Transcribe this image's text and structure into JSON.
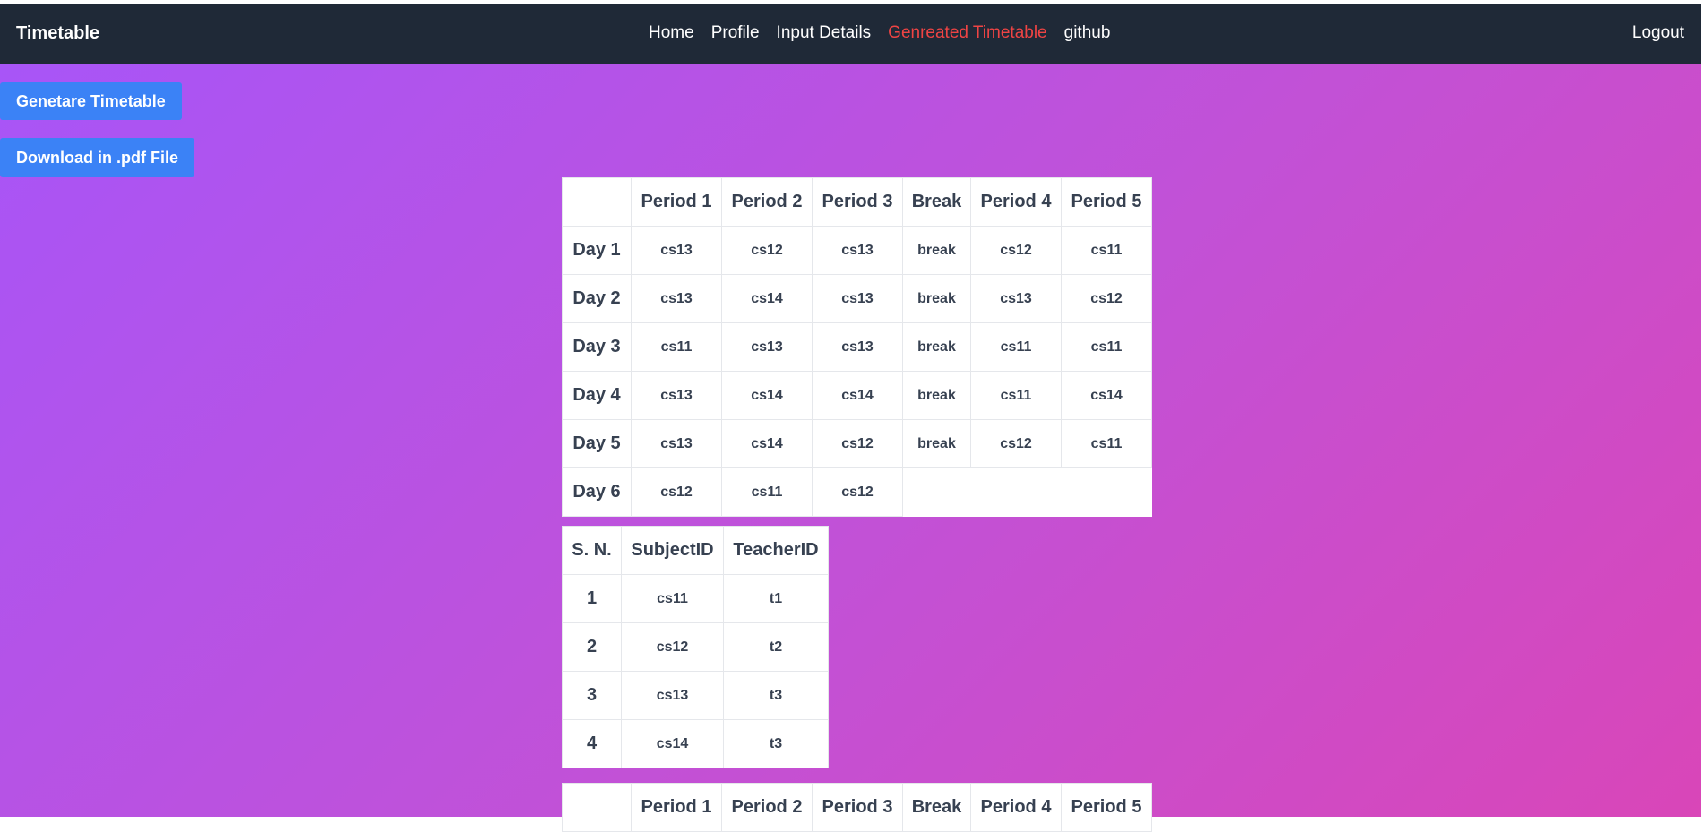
{
  "nav": {
    "brand": "Timetable",
    "links": [
      "Home",
      "Profile",
      "Input Details",
      "Genreated Timetable",
      "github"
    ],
    "logout": "Logout"
  },
  "actions": {
    "generate": "Genetare Timetable",
    "download": "Download in .pdf File"
  },
  "timetable": {
    "headers": [
      "",
      "Period 1",
      "Period 2",
      "Period 3",
      "Break",
      "Period 4",
      "Period 5"
    ],
    "rows": [
      [
        "Day 1",
        "cs13",
        "cs12",
        "cs13",
        "break",
        "cs12",
        "cs11"
      ],
      [
        "Day 2",
        "cs13",
        "cs14",
        "cs13",
        "break",
        "cs13",
        "cs12"
      ],
      [
        "Day 3",
        "cs11",
        "cs13",
        "cs13",
        "break",
        "cs11",
        "cs11"
      ],
      [
        "Day 4",
        "cs13",
        "cs14",
        "cs14",
        "break",
        "cs11",
        "cs14"
      ],
      [
        "Day 5",
        "cs13",
        "cs14",
        "cs12",
        "break",
        "cs12",
        "cs11"
      ],
      [
        "Day 6",
        "cs12",
        "cs11",
        "cs12"
      ]
    ]
  },
  "subjects": {
    "headers": [
      "S. N.",
      "SubjectID",
      "TeacherID"
    ],
    "rows": [
      [
        "1",
        "cs11",
        "t1"
      ],
      [
        "2",
        "cs12",
        "t2"
      ],
      [
        "3",
        "cs13",
        "t3"
      ],
      [
        "4",
        "cs14",
        "t3"
      ]
    ]
  },
  "timetable2": {
    "headers": [
      "",
      "Period 1",
      "Period 2",
      "Period 3",
      "Break",
      "Period 4",
      "Period 5"
    ]
  }
}
